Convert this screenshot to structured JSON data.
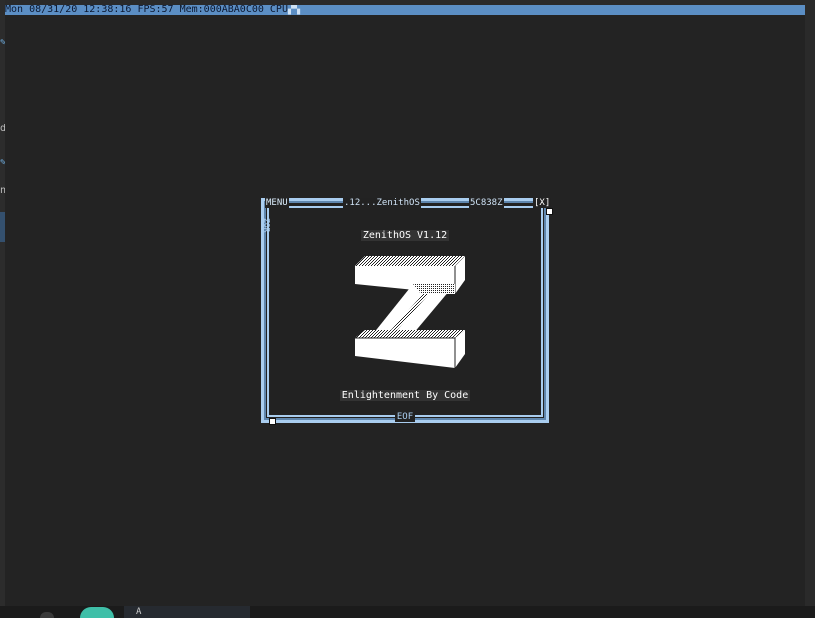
{
  "status_bar": {
    "text": "Mon 08/31/20 12:38:16 FPS:57 Mem:000ABA0C00 CPU",
    "cpu_graph": "▞▚"
  },
  "window": {
    "menu_label": "MENU",
    "title": ".12...ZenithOS",
    "coords": "5C838Z",
    "close_label": "[X]",
    "side_label": "ZOR",
    "footer_label": "EOF"
  },
  "content": {
    "app_title": "ZenithOS V1.12",
    "tagline": "Enlightenment By Code",
    "logo_icon": "zenith-z-logo-icon"
  },
  "taskbar": {
    "tab_label": "A"
  },
  "colors": {
    "status_bar": "#5b8ec4",
    "window_frame": "#a9cdef",
    "screen_bg": "#232323"
  }
}
